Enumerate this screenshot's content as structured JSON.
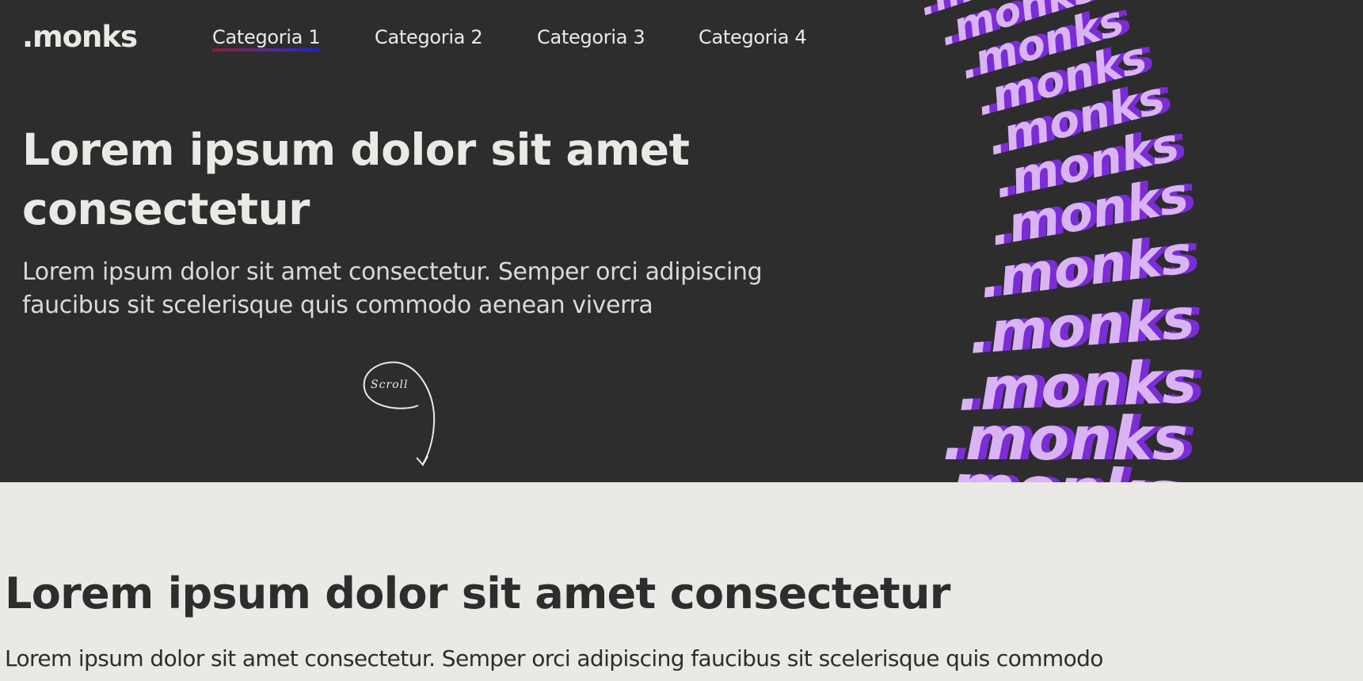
{
  "brand": {
    "logo": ".monks"
  },
  "nav": {
    "items": [
      {
        "label": "Categoria 1",
        "active": true
      },
      {
        "label": "Categoria 2",
        "active": false
      },
      {
        "label": "Categoria 3",
        "active": false
      },
      {
        "label": "Categoria 4",
        "active": false
      }
    ]
  },
  "hero": {
    "title": "Lorem ipsum dolor sit amet consectetur",
    "subtitle": "Lorem ipsum dolor sit amet consectetur. Semper orci adipiscing faucibus sit scelerisque quis commodo aenean viverra",
    "scroll_label": "Scroll",
    "art_word": ".monks"
  },
  "section": {
    "title": "Lorem ipsum dolor sit amet consectetur",
    "text": "Lorem ipsum dolor sit amet consectetur. Semper orci adipiscing faucibus sit scelerisque quis commodo"
  },
  "colors": {
    "hero_bg": "#2d2d2d",
    "page_bg": "#eae9e5",
    "text_light": "#eae9e5",
    "text_dark": "#2d2d2d",
    "art_front": "#dab3f5",
    "art_shadow": "#7b2cd6"
  }
}
